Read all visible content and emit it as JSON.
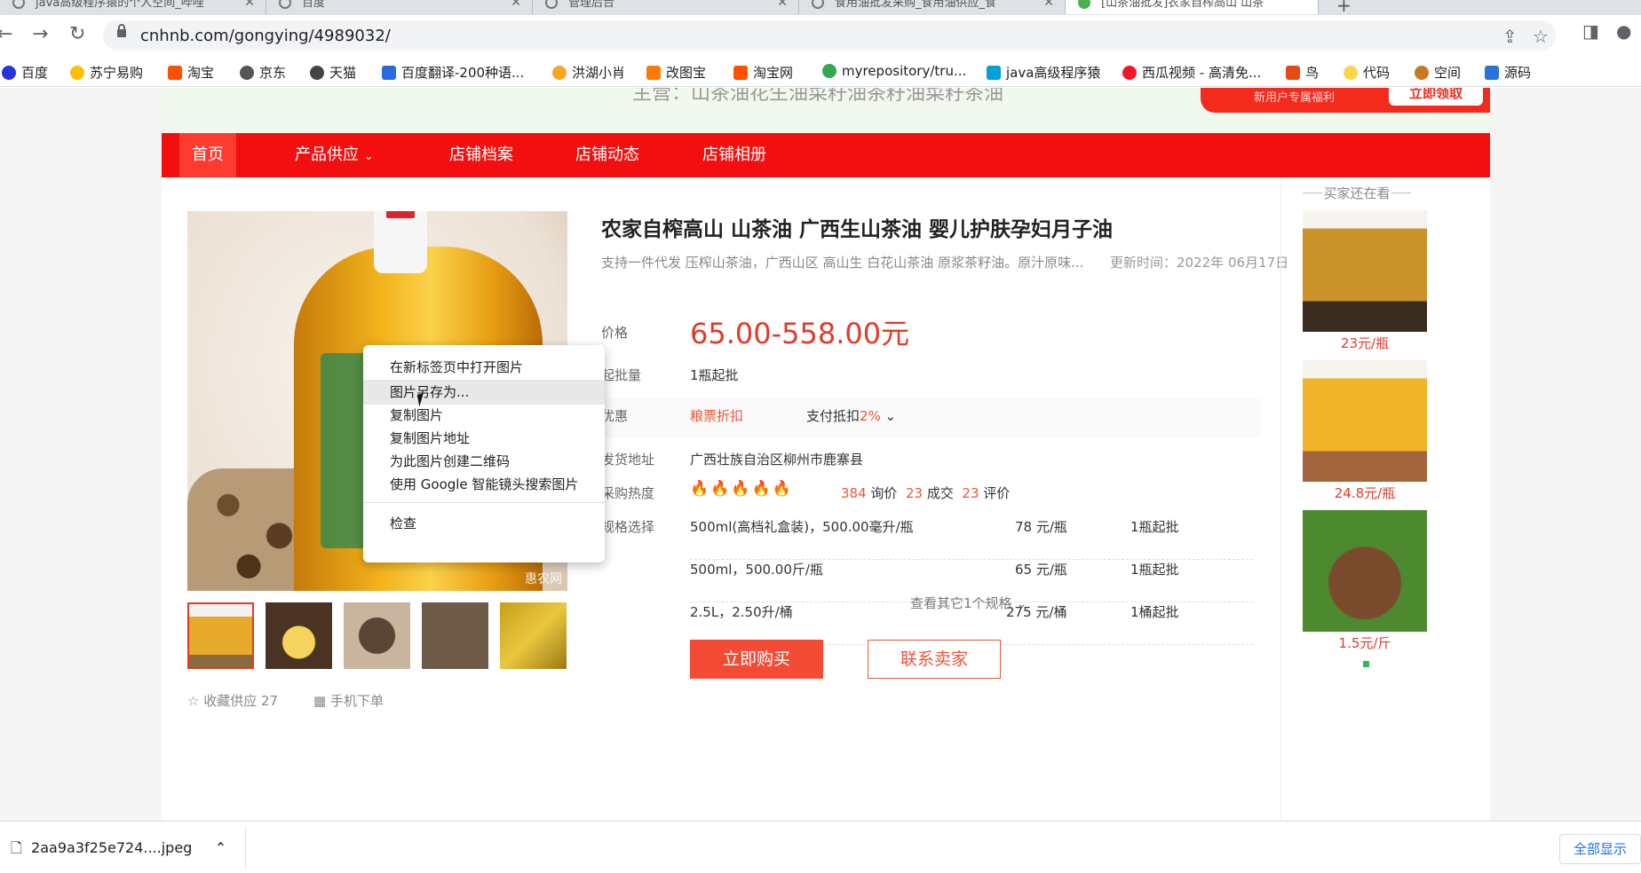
{
  "browser": {
    "tabs": [
      {
        "label": "java高级程序猿的个人空间_哔哩"
      },
      {
        "label": "百度"
      },
      {
        "label": "管理后台"
      },
      {
        "label": "食用油批发采购_食用油供应_食"
      },
      {
        "label": "[山茶油批发]农家自榨高山 山茶"
      }
    ],
    "url": "cnhnb.com/gongying/4989032/",
    "bookmarks": [
      {
        "label": "百度",
        "color": "#2932e1"
      },
      {
        "label": "苏宁易购",
        "color": "#ffbf00"
      },
      {
        "label": "淘宝",
        "color": "#ff5000"
      },
      {
        "label": "京东",
        "color": "#555"
      },
      {
        "label": "天猫",
        "color": "#444"
      },
      {
        "label": "百度翻译-200种语...",
        "color": "#2a6ae3"
      },
      {
        "label": "洪湖小肖",
        "color": "#f5a623"
      },
      {
        "label": "改图宝",
        "color": "#ff7a00"
      },
      {
        "label": "淘宝网",
        "color": "#ff5000"
      },
      {
        "label": "myrepository/tru...",
        "color": "#34a853"
      },
      {
        "label": "java高级程序猿",
        "color": "#00a1d6"
      },
      {
        "label": "西瓜视频 - 高清免...",
        "color": "#f2162b"
      },
      {
        "label": "鸟",
        "color": "#e64a19"
      },
      {
        "label": "代码",
        "color": "#f9d64a"
      },
      {
        "label": "空间",
        "color": "#c77a1e"
      },
      {
        "label": "源码",
        "color": "#2a73d9"
      }
    ]
  },
  "nav": {
    "items": [
      "首页",
      "产品供应",
      "店铺档案",
      "店铺动态",
      "店铺相册"
    ]
  },
  "product": {
    "title": "农家自榨高山 山茶油 广西生山茶油 婴儿护肤孕妇月子油",
    "subtitle": "支持一件代发 压榨山茶油，广西山区 高山生 白花山茶油 原浆茶籽油。原汁原味...",
    "updated": "更新时间：2022年 06月17日",
    "price_label": "价格",
    "price": "65.00-558.00元",
    "moq_label": "起批量",
    "moq": "1瓶起批",
    "promo_label": "优惠",
    "promo_1": "粮票折扣",
    "promo_2_text": "支付抵扣",
    "promo_2_pct": "2%",
    "ship_label": "发货地址",
    "ship": "广西壮族自治区柳州市鹿寨县",
    "heat_label": "采购热度",
    "inquiries": "384",
    "inquiries_label": "询价",
    "deals": "23",
    "deals_label": "成交",
    "reviews": "23",
    "reviews_label": "评价",
    "spec_label": "规格选择",
    "specs": [
      {
        "name": "500ml(高档礼盒装)，500.00毫升/瓶",
        "price": "78 元/瓶",
        "moq": "1瓶起批"
      },
      {
        "name": "500ml，500.00斤/瓶",
        "price": "65 元/瓶",
        "moq": "1瓶起批"
      },
      {
        "name": "2.5L，2.50升/桶",
        "price": "275 元/桶",
        "moq": "1桶起批"
      }
    ],
    "more_specs": "查看其它1个规格",
    "favorite": "收藏供应 27",
    "mobile_order": "手机下单",
    "buy_btn": "立即购买",
    "contact_btn": "联系卖家",
    "watermark": "惠农网"
  },
  "sidebar": {
    "title": "买家还在看",
    "items": [
      {
        "price": "23元/瓶"
      },
      {
        "price": "24.8元/瓶"
      },
      {
        "price": "1.5元/斤"
      }
    ]
  },
  "ad": {
    "text": "主营：山茶油花生油菜籽油茶籽油菜籽茶油",
    "label": "新用户专属福利",
    "button": "立即领取"
  },
  "context_menu": {
    "items": [
      "在新标签页中打开图片",
      "图片另存为...",
      "复制图片",
      "复制图片地址",
      "为此图片创建二维码",
      "使用 Google 智能镜头搜索图片",
      "检查"
    ]
  },
  "download": {
    "file": "2aa9a3f25e724....jpeg",
    "show_all": "全部显示"
  }
}
